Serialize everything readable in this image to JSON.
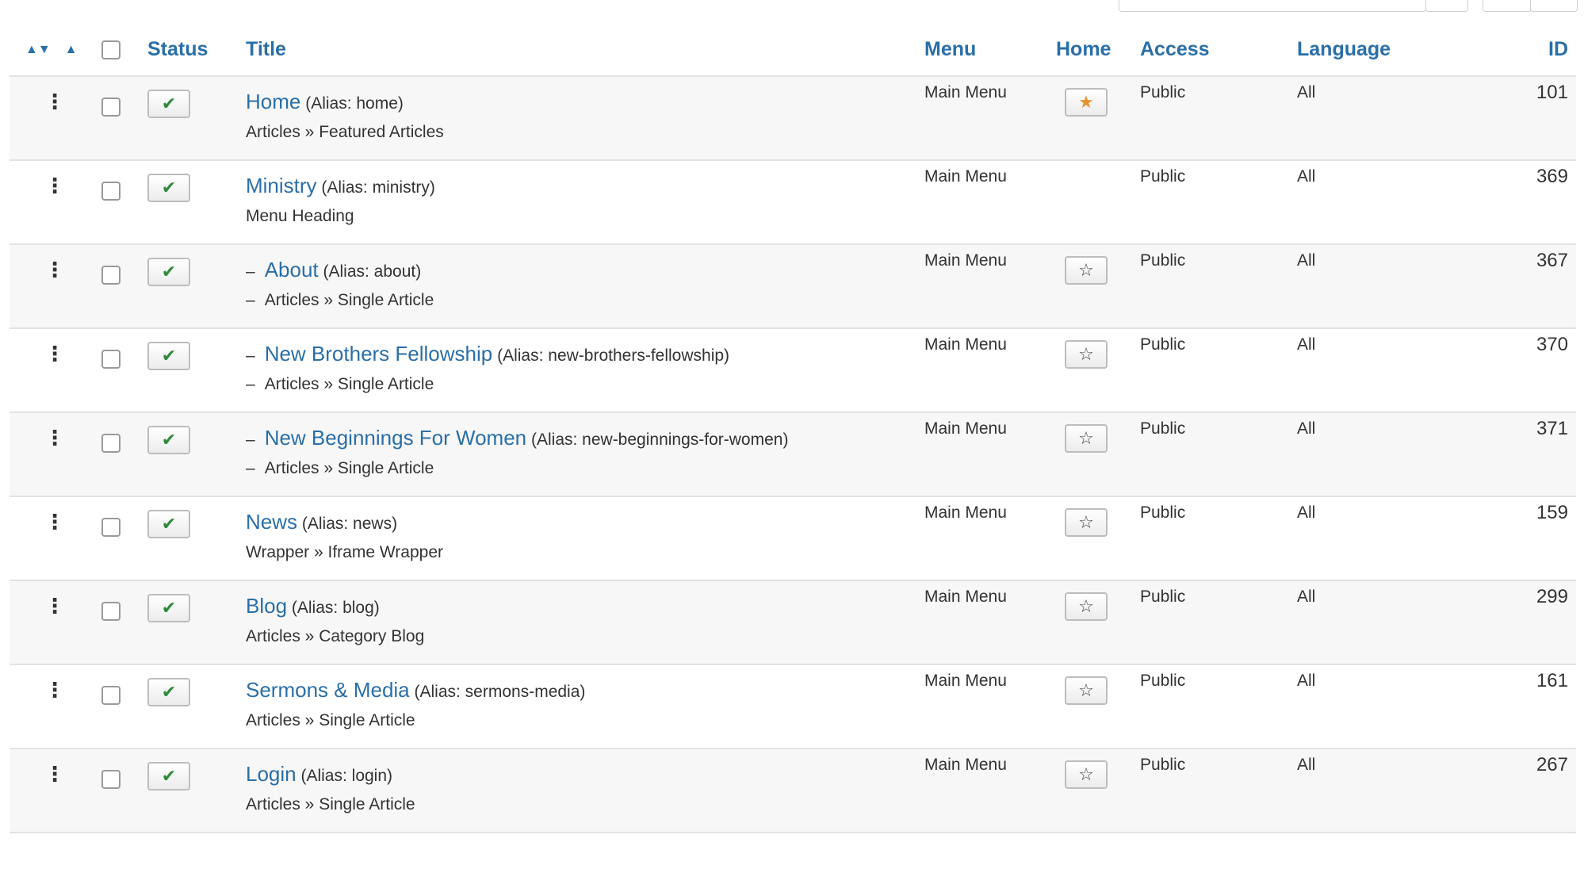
{
  "headers": {
    "status": "Status",
    "title": "Title",
    "menu": "Menu",
    "home": "Home",
    "access": "Access",
    "language": "Language",
    "id": "ID"
  },
  "colors": {
    "link": "#2a6fa8",
    "status_check": "#2f8a3c",
    "home_star_active": "#e3942f",
    "row_stripe": "#f7f7f7"
  },
  "icons": {
    "ordering_sort": "sort-icon",
    "ordering_asc": "caret-up-icon",
    "drag": "drag-handle-icon",
    "status": "check-icon",
    "home_default": "star-filled-icon",
    "home_not_default": "star-empty-icon"
  },
  "rows": [
    {
      "title": "Home",
      "alias": "(Alias: home)",
      "type": "Articles » Featured Articles",
      "menu": "Main Menu",
      "home": true,
      "show_home_button": true,
      "access": "Public",
      "language": "All",
      "id": "101",
      "level": 1
    },
    {
      "title": "Ministry",
      "alias": "(Alias: ministry)",
      "type": "Menu Heading",
      "menu": "Main Menu",
      "home": false,
      "show_home_button": false,
      "access": "Public",
      "language": "All",
      "id": "369",
      "level": 1
    },
    {
      "title": "About",
      "alias": "(Alias: about)",
      "type": "Articles » Single Article",
      "menu": "Main Menu",
      "home": false,
      "show_home_button": true,
      "access": "Public",
      "language": "All",
      "id": "367",
      "level": 2
    },
    {
      "title": "New Brothers Fellowship",
      "alias": "(Alias: new-brothers-fellowship)",
      "type": "Articles » Single Article",
      "menu": "Main Menu",
      "home": false,
      "show_home_button": true,
      "access": "Public",
      "language": "All",
      "id": "370",
      "level": 2
    },
    {
      "title": "New Beginnings For Women",
      "alias": "(Alias: new-beginnings-for-women)",
      "type": "Articles » Single Article",
      "menu": "Main Menu",
      "home": false,
      "show_home_button": true,
      "access": "Public",
      "language": "All",
      "id": "371",
      "level": 2
    },
    {
      "title": "News",
      "alias": "(Alias: news)",
      "type": "Wrapper » Iframe Wrapper",
      "menu": "Main Menu",
      "home": false,
      "show_home_button": true,
      "access": "Public",
      "language": "All",
      "id": "159",
      "level": 1
    },
    {
      "title": "Blog",
      "alias": "(Alias: blog)",
      "type": "Articles » Category Blog",
      "menu": "Main Menu",
      "home": false,
      "show_home_button": true,
      "access": "Public",
      "language": "All",
      "id": "299",
      "level": 1
    },
    {
      "title": "Sermons & Media",
      "alias": "(Alias: sermons-media)",
      "type": "Articles » Single Article",
      "menu": "Main Menu",
      "home": false,
      "show_home_button": true,
      "access": "Public",
      "language": "All",
      "id": "161",
      "level": 1
    },
    {
      "title": "Login",
      "alias": "(Alias: login)",
      "type": "Articles » Single Article",
      "menu": "Main Menu",
      "home": false,
      "show_home_button": true,
      "access": "Public",
      "language": "All",
      "id": "267",
      "level": 1
    }
  ]
}
